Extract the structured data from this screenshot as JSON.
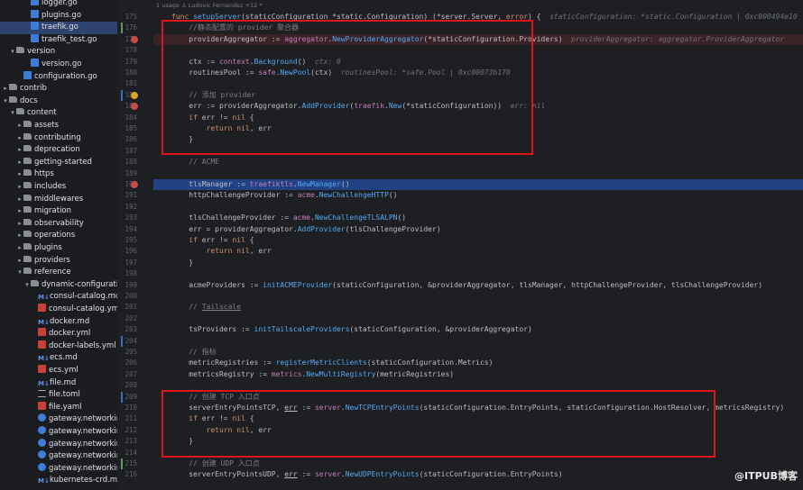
{
  "sidebar": {
    "items": [
      {
        "label": "logger.go",
        "indent": 3,
        "icon": "go",
        "arrow": ""
      },
      {
        "label": "plugins.go",
        "indent": 3,
        "icon": "go",
        "arrow": ""
      },
      {
        "label": "traefik.go",
        "indent": 3,
        "icon": "go",
        "arrow": "",
        "selected": true
      },
      {
        "label": "traefik_test.go",
        "indent": 3,
        "icon": "go",
        "arrow": ""
      },
      {
        "label": "version",
        "indent": 1,
        "icon": "folder",
        "arrow": "▾"
      },
      {
        "label": "version.go",
        "indent": 3,
        "icon": "go",
        "arrow": ""
      },
      {
        "label": "configuration.go",
        "indent": 2,
        "icon": "go",
        "arrow": ""
      },
      {
        "label": "contrib",
        "indent": 0,
        "icon": "folder",
        "arrow": "▸"
      },
      {
        "label": "docs",
        "indent": 0,
        "icon": "folder",
        "arrow": "▾"
      },
      {
        "label": "content",
        "indent": 1,
        "icon": "folder",
        "arrow": "▾"
      },
      {
        "label": "assets",
        "indent": 2,
        "icon": "folder",
        "arrow": "▸"
      },
      {
        "label": "contributing",
        "indent": 2,
        "icon": "folder",
        "arrow": "▸"
      },
      {
        "label": "deprecation",
        "indent": 2,
        "icon": "folder",
        "arrow": "▸"
      },
      {
        "label": "getting-started",
        "indent": 2,
        "icon": "folder",
        "arrow": "▸"
      },
      {
        "label": "https",
        "indent": 2,
        "icon": "folder",
        "arrow": "▸"
      },
      {
        "label": "includes",
        "indent": 2,
        "icon": "folder",
        "arrow": "▸"
      },
      {
        "label": "middlewares",
        "indent": 2,
        "icon": "folder",
        "arrow": "▸"
      },
      {
        "label": "migration",
        "indent": 2,
        "icon": "folder",
        "arrow": "▸"
      },
      {
        "label": "observability",
        "indent": 2,
        "icon": "folder",
        "arrow": "▸"
      },
      {
        "label": "operations",
        "indent": 2,
        "icon": "folder",
        "arrow": "▸"
      },
      {
        "label": "plugins",
        "indent": 2,
        "icon": "folder",
        "arrow": "▸"
      },
      {
        "label": "providers",
        "indent": 2,
        "icon": "folder",
        "arrow": "▸"
      },
      {
        "label": "reference",
        "indent": 2,
        "icon": "folder",
        "arrow": "▾"
      },
      {
        "label": "dynamic-configuration",
        "indent": 3,
        "icon": "folder",
        "arrow": "▾"
      },
      {
        "label": "consul-catalog.md",
        "indent": 4,
        "icon": "md",
        "arrow": ""
      },
      {
        "label": "consul-catalog.yml",
        "indent": 4,
        "icon": "yml",
        "arrow": ""
      },
      {
        "label": "docker.md",
        "indent": 4,
        "icon": "md",
        "arrow": ""
      },
      {
        "label": "docker.yml",
        "indent": 4,
        "icon": "yml",
        "arrow": ""
      },
      {
        "label": "docker-labels.yml",
        "indent": 4,
        "icon": "yml",
        "arrow": ""
      },
      {
        "label": "ecs.md",
        "indent": 4,
        "icon": "md",
        "arrow": ""
      },
      {
        "label": "ecs.yml",
        "indent": 4,
        "icon": "yml",
        "arrow": ""
      },
      {
        "label": "file.md",
        "indent": 4,
        "icon": "md",
        "arrow": ""
      },
      {
        "label": "file.toml",
        "indent": 4,
        "icon": "toml",
        "arrow": ""
      },
      {
        "label": "file.yaml",
        "indent": 4,
        "icon": "yml",
        "arrow": ""
      },
      {
        "label": "gateway.networkin",
        "indent": 4,
        "icon": "link",
        "arrow": ""
      },
      {
        "label": "gateway.networkin",
        "indent": 4,
        "icon": "link",
        "arrow": ""
      },
      {
        "label": "gateway.networkin",
        "indent": 4,
        "icon": "link",
        "arrow": ""
      },
      {
        "label": "gateway.networkin",
        "indent": 4,
        "icon": "link",
        "arrow": ""
      },
      {
        "label": "gateway.networkin",
        "indent": 4,
        "icon": "link",
        "arrow": ""
      },
      {
        "label": "kubernetes-crd.md",
        "indent": 4,
        "icon": "md",
        "arrow": ""
      }
    ]
  },
  "editor": {
    "usages": "1 usage   ♙ Ludovic Fernandez +12 *",
    "lines": [
      {
        "n": "175",
        "html": "<span class=kw>func</span> <span class=fn>setupServer</span>(staticConfiguration *<span class=typ>static.Configuration</span>) (*<span class=typ>server.Server</span>, <span class=kw>error</span>) {  <span class=hint>staticConfiguration: *static.Configuration | 0xc000494e10</span>"
      },
      {
        "n": "176",
        "html": "<span class=cm>    //静态配置的 provider 聚合器</span>"
      },
      {
        "n": "177",
        "html": "    providerAggregator := <span class=pk>aggregator</span>.<span class=fn>NewProviderAggregator</span>(*staticConfiguration.Providers)  <span class=hint>providerAggregator: aggregator.ProviderAggregator</span>",
        "bg": "red"
      },
      {
        "n": "178",
        "html": ""
      },
      {
        "n": "179",
        "html": "    ctx := <span class=pk>context</span>.<span class=fn>Background</span>()  <span class=hint>ctx: 0</span>"
      },
      {
        "n": "180",
        "html": "    routinesPool := <span class=pk>safe</span>.<span class=fn>NewPool</span>(ctx)  <span class=hint>routinesPool: *safe.Pool | 0xc00073b170</span>"
      },
      {
        "n": "181",
        "html": ""
      },
      {
        "n": "182",
        "html": "<span class=cm>    // 添加 provider</span>"
      },
      {
        "n": "183",
        "html": "    err := providerAggregator.<span class=fn>AddProvider</span>(<span class=pk>traefik</span>.<span class=fn>New</span>(*staticConfiguration))  <span class=hint>err: nil</span>"
      },
      {
        "n": "184",
        "html": "    <span class=kw>if</span> err != <span class=kw>nil</span> {"
      },
      {
        "n": "185",
        "html": "        <span class=kw>return</span> <span class=kw>nil</span>, err"
      },
      {
        "n": "186",
        "html": "    }"
      },
      {
        "n": "187",
        "html": ""
      },
      {
        "n": "188",
        "html": "<span class=cm>    // ACME</span>"
      },
      {
        "n": "189",
        "html": ""
      },
      {
        "n": "190",
        "html": "    tlsManager := <span class=pk>traefiktls</span>.<span class=fn>NewManager</span>()",
        "bg": "blue"
      },
      {
        "n": "191",
        "html": "    httpChallengeProvider := <span class=pk>acme</span>.<span class=fn>NewChallengeHTTP</span>()"
      },
      {
        "n": "192",
        "html": ""
      },
      {
        "n": "193",
        "html": "    tlsChallengeProvider := <span class=pk>acme</span>.<span class=fn>NewChallengeTLSALPN</span>()"
      },
      {
        "n": "194",
        "html": "    err = providerAggregator.<span class=fn>AddProvider</span>(tlsChallengeProvider)"
      },
      {
        "n": "195",
        "html": "    <span class=kw>if</span> err != <span class=kw>nil</span> {"
      },
      {
        "n": "196",
        "html": "        <span class=kw>return</span> <span class=kw>nil</span>, err"
      },
      {
        "n": "197",
        "html": "    }"
      },
      {
        "n": "198",
        "html": ""
      },
      {
        "n": "199",
        "html": "    acmeProviders := <span class=fn>initACMEProvider</span>(staticConfiguration, &providerAggregator, tlsManager, httpChallengeProvider, tlsChallengeProvider)"
      },
      {
        "n": "200",
        "html": ""
      },
      {
        "n": "201",
        "html": "<span class=cm>    // <u>Tailscale</u></span>"
      },
      {
        "n": "202",
        "html": ""
      },
      {
        "n": "203",
        "html": "    tsProviders := <span class=fn>initTailscaleProviders</span>(staticConfiguration, &providerAggregator)"
      },
      {
        "n": "204",
        "html": ""
      },
      {
        "n": "205",
        "html": "<span class=cm>    // 指标</span>"
      },
      {
        "n": "206",
        "html": "    metricRegistries := <span class=fn>registerMetricClients</span>(staticConfiguration.Metrics)"
      },
      {
        "n": "207",
        "html": "    metricsRegistry := <span class=pk>metrics</span>.<span class=fn>NewMultiRegistry</span>(metricRegistries)"
      },
      {
        "n": "208",
        "html": ""
      },
      {
        "n": "209",
        "html": "<span class=cm>    // 创建 TCP 入口点</span>"
      },
      {
        "n": "210",
        "html": "    serverEntryPointsTCP, <u>err</u> := <span class=pk>server</span>.<span class=fn>NewTCPEntryPoints</span>(staticConfiguration.EntryPoints, staticConfiguration.HostResolver, metricsRegistry)"
      },
      {
        "n": "211",
        "html": "    <span class=kw>if</span> err != <span class=kw>nil</span> {"
      },
      {
        "n": "212",
        "html": "        <span class=kw>return</span> <span class=kw>nil</span>, err"
      },
      {
        "n": "213",
        "html": "    }"
      },
      {
        "n": "214",
        "html": ""
      },
      {
        "n": "215",
        "html": "<span class=cm>    // 创建 UDP 入口点</span>"
      },
      {
        "n": "216",
        "html": "    serverEntryPointsUDP, <u>err</u> := <span class=pk>server</span>.<span class=fn>NewUDPEntryPoints</span>(staticConfiguration.EntryPoints)"
      }
    ]
  },
  "watermark": "@ITPUB博客"
}
